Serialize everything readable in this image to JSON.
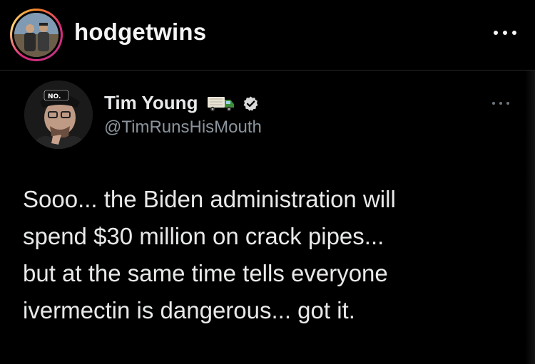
{
  "instagram_post": {
    "username": "hodgetwins",
    "more_icon": "more-horizontal-icon"
  },
  "tweet": {
    "display_name": "Tim Young",
    "name_emoji": "delivery-truck-emoji",
    "verified_icon": "verified-badge-icon",
    "handle": "@TimRunsHisMouth",
    "more_icon": "more-horizontal-icon",
    "text_lines": [
      "Sooo... the Biden administration will",
      "spend $30 million on crack pipes...",
      "but at the same time tells everyone",
      "ivermectin is dangerous... got it."
    ]
  },
  "colors": {
    "background": "#000000",
    "text_primary": "#e7e9ea",
    "text_secondary": "#8b949c",
    "verified": "#d9d9d9",
    "truck_cab": "#3c8d3a"
  }
}
